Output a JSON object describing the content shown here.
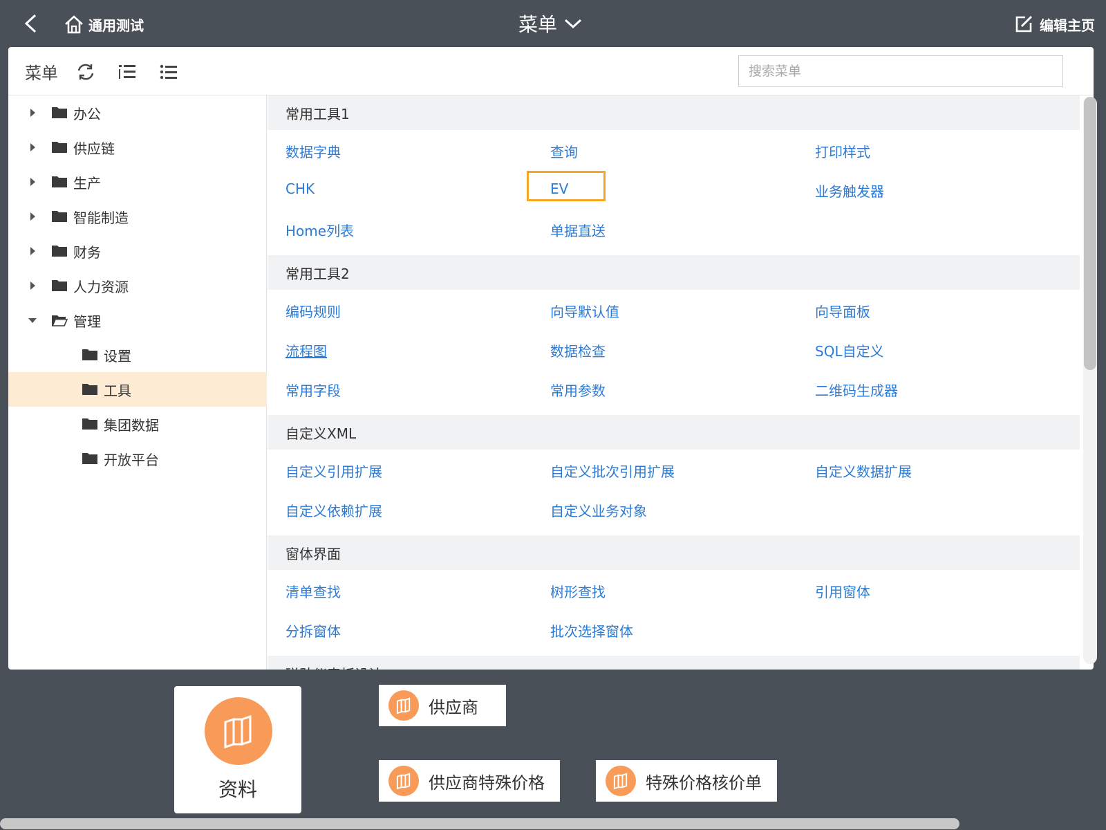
{
  "header": {
    "back_icon": "chevron-left-icon",
    "home_label": "通用测试",
    "title": "菜单",
    "edit_label": "编辑主页"
  },
  "panel": {
    "menu_label": "菜单",
    "search_placeholder": "搜索菜单",
    "search_value": "",
    "toolbar_icons": [
      "refresh-icon",
      "indent-list-icon",
      "bullet-list-icon"
    ]
  },
  "tree": [
    {
      "label": "办公",
      "expanded": false
    },
    {
      "label": "供应链",
      "expanded": false
    },
    {
      "label": "生产",
      "expanded": false
    },
    {
      "label": "智能制造",
      "expanded": false
    },
    {
      "label": "财务",
      "expanded": false
    },
    {
      "label": "人力资源",
      "expanded": false
    },
    {
      "label": "管理",
      "expanded": true
    },
    {
      "label": "设置"
    },
    {
      "label": "工具",
      "selected": true
    },
    {
      "label": "集团数据"
    },
    {
      "label": "开放平台"
    }
  ],
  "sections": [
    {
      "title": "常用工具1",
      "items": [
        "数据字典",
        "查询",
        "打印样式",
        "CHK",
        "EV",
        "业务触发器",
        "Home列表",
        "单据直送"
      ]
    },
    {
      "title": "常用工具2",
      "items": [
        "编码规则",
        "向导默认值",
        "向导面板",
        "流程图",
        "数据检查",
        "SQL自定义",
        "常用字段",
        "常用参数",
        "二维码生成器"
      ]
    },
    {
      "title": "自定义XML",
      "items": [
        "自定义引用扩展",
        "自定义批次引用扩展",
        "自定义数据扩展",
        "自定义依赖扩展",
        "自定义业务对象"
      ]
    },
    {
      "title": "窗体界面",
      "items": [
        "清单查找",
        "树形查找",
        "引用窗体",
        "分拆窗体",
        "批次选择窗体"
      ]
    },
    {
      "title": "磁贴仪表板设计",
      "items": []
    }
  ],
  "highlighted_item": "EV",
  "underlined_item": "流程图",
  "tiles": {
    "big": {
      "label": "资料",
      "icon": "books-icon"
    },
    "small": [
      {
        "label": "供应商",
        "icon": "books-icon"
      },
      {
        "label": "供应商特殊价格",
        "icon": "books-icon"
      },
      {
        "label": "特殊价格核价单",
        "icon": "books-icon"
      }
    ]
  },
  "colors": {
    "background": "#495057",
    "link": "#2c7bd4",
    "accent": "#f99b58",
    "highlight_border": "#f5a623",
    "selected_row": "#fdebd3"
  }
}
